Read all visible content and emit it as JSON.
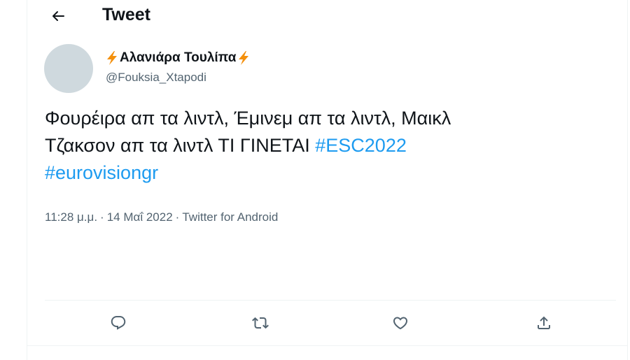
{
  "header": {
    "back_icon": "arrow-left-icon",
    "title": "Tweet"
  },
  "author": {
    "display_name": "Αλανιάρα Τουλίπα",
    "name_emoji": "high-voltage-emoji",
    "handle": "@Fouksia_Xtapodi",
    "avatar_color": "#cfd9de"
  },
  "tweet": {
    "text_line_1": "Φουρέιρα απ τα λιντλ, Έμινεμ απ τα λιντλ, Μαικλ",
    "text_line_2": "Τζακσον απ τα λιντλ ΤΙ ΓΙΝΕΤΑΙ ",
    "hashtag_1": "#ESC2022",
    "hashtag_2": "#eurovisiongr",
    "hashtag_color": "#1d9bf0"
  },
  "meta": {
    "time": "11:28 μ.μ.",
    "separator": "·",
    "date": "14 Μαΐ 2022",
    "source": "Twitter for Android"
  },
  "actions": [
    {
      "name": "reply",
      "icon": "reply-icon"
    },
    {
      "name": "retweet",
      "icon": "retweet-icon"
    },
    {
      "name": "like",
      "icon": "heart-icon"
    },
    {
      "name": "share",
      "icon": "share-icon"
    }
  ]
}
